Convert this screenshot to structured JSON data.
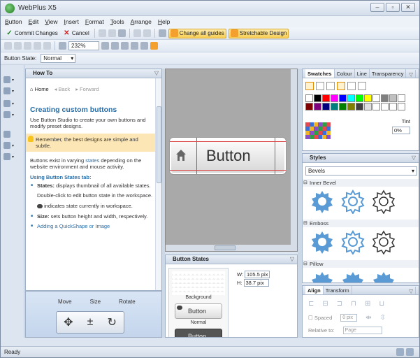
{
  "window": {
    "title": "WebPlus X5",
    "buttons": [
      "‒",
      "▫",
      "✕"
    ]
  },
  "menu": [
    "Button",
    "Edit",
    "View",
    "Insert",
    "Format",
    "Tools",
    "Arrange",
    "Help"
  ],
  "toolbar1": {
    "commit": "Commit Changes",
    "cancel": "Cancel",
    "change_guides": "Change all guides",
    "stretchable": "Stretchable Design"
  },
  "toolbar2": {
    "zoom": "232%"
  },
  "toolbar3": {
    "state_label": "Button State:",
    "state_value": "Normal"
  },
  "howto": {
    "title": "How To",
    "nav_home": "Home",
    "nav_back": "Back",
    "nav_forward": "Forward",
    "heading": "Creating custom buttons",
    "intro": "Use Button Studio to create your own buttons and modify preset designs.",
    "tip": "Remember, the best designs are simple and subtle.",
    "states_pre": "Buttons exist in varying ",
    "states_link": "states",
    "states_post": " depending on the website environment and mouse activity.",
    "subheading": "Using Button States tab:",
    "b1_bold": "States:",
    "b1_text": " displays thumbnail of all available states.",
    "b1_p2": "Double-click to edit button state in the workspace.",
    "b1_p3": " indicates state currently in workspace.",
    "b2_bold": "Size:",
    "b2_text": " sets button height and width, respectively.",
    "b3_link": "Adding a QuickShape or Image"
  },
  "move_panel": {
    "move": "Move",
    "size": "Size",
    "rotate": "Rotate"
  },
  "canvas": {
    "button_label": "Button"
  },
  "button_states": {
    "title": "Button States",
    "background": "Background",
    "mini_label": "Button",
    "normal": "Normal",
    "w_label": "W:",
    "w_value": "105.5 pix",
    "h_label": "H:",
    "h_value": "38.7 pix"
  },
  "swatches": {
    "tabs": [
      "Swatches",
      "Colour",
      "Line",
      "Transparency"
    ],
    "tint_label": "Tint",
    "tint_value": "0%",
    "colors": [
      "#ffffff",
      "#000000",
      "#ff0000",
      "#ff00ff",
      "#0000ff",
      "#00ffff",
      "#00ff00",
      "#ffff00",
      "#ffffff",
      "#7f7f7f",
      "#c0c0c0",
      "#ffffff",
      "#7f0000",
      "#7f007f",
      "#00007f",
      "#007f7f",
      "#007f00",
      "#7f7f00",
      "#404040",
      "#e0e0e0",
      "#ffffff",
      "#ffffff",
      "#ffffff",
      "#ffffff"
    ]
  },
  "styles": {
    "title": "Styles",
    "category": "Bevels",
    "groups": [
      "Inner Bevel",
      "Emboss",
      "Pillow"
    ]
  },
  "align": {
    "tabs": [
      "Align",
      "Transform"
    ],
    "spaced": "Spaced",
    "spaced_value": "0 pix",
    "relative_label": "Relative to:",
    "relative_value": "Page"
  },
  "status": {
    "text": "Ready"
  },
  "colors": {
    "accent": "#2a6fa8",
    "tip_bg": "#fde6b5",
    "highlight": "#f8cf55",
    "gear": "#5b9bd5"
  }
}
